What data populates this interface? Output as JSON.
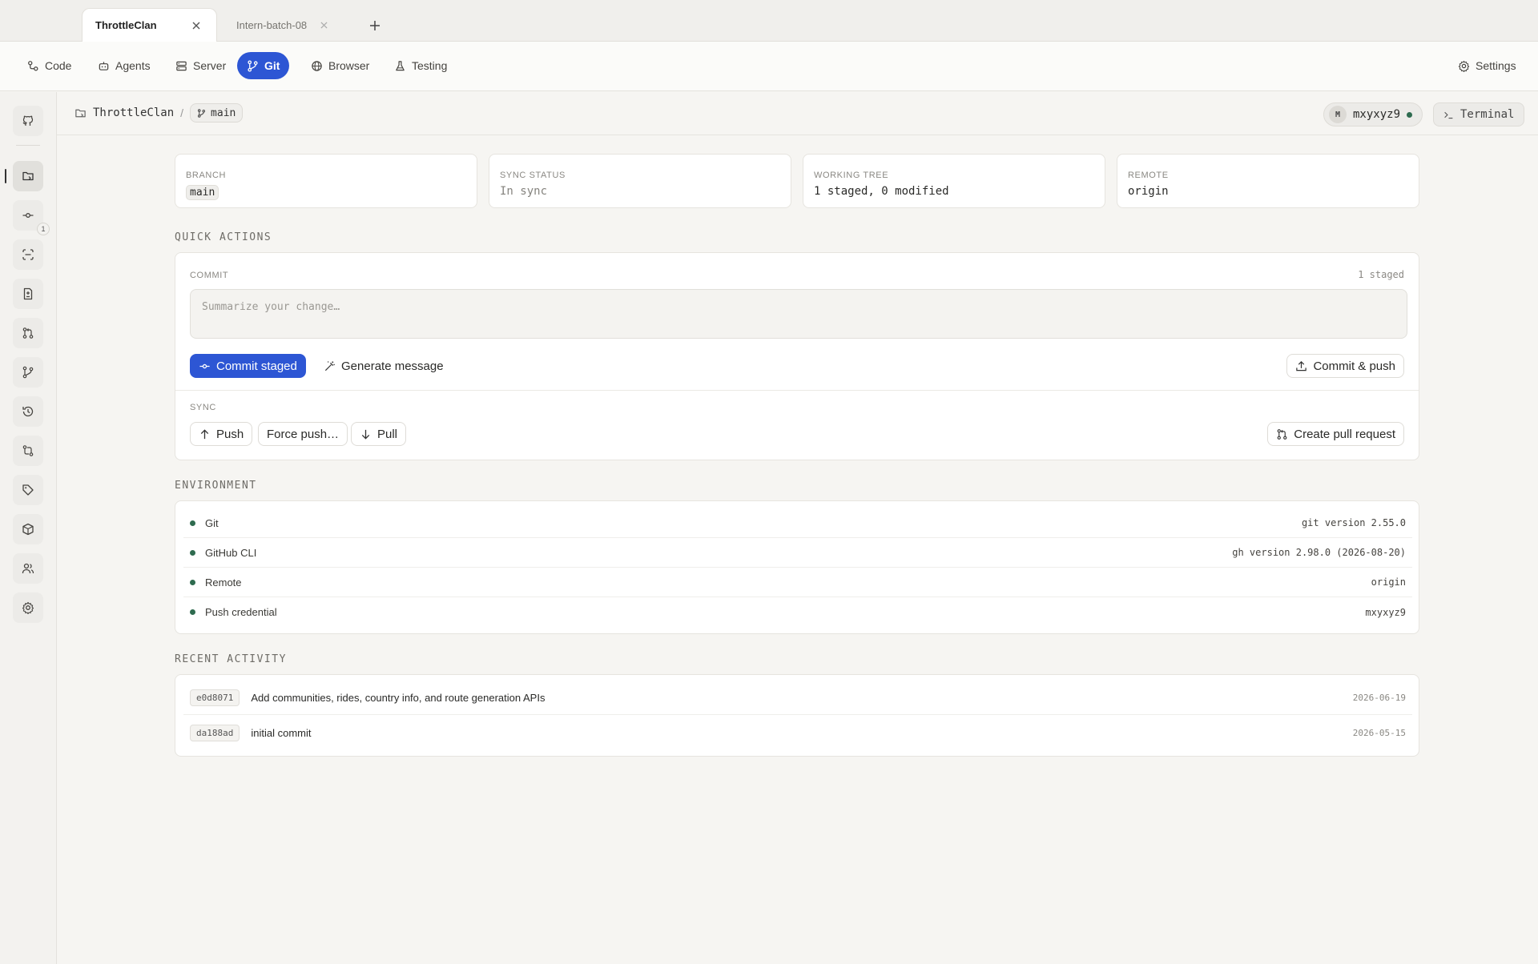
{
  "tabs": [
    {
      "label": "ThrottleClan",
      "active": true
    },
    {
      "label": "Intern-batch-08",
      "active": false
    }
  ],
  "nav": {
    "items": [
      {
        "label": "Code",
        "icon": "code-icon"
      },
      {
        "label": "Agents",
        "icon": "robot-icon"
      },
      {
        "label": "Server",
        "icon": "server-icon"
      },
      {
        "label": "Git",
        "icon": "git-branch-icon",
        "active": true
      },
      {
        "label": "Browser",
        "icon": "globe-icon"
      },
      {
        "label": "Testing",
        "icon": "flask-icon"
      }
    ],
    "settings_label": "Settings"
  },
  "rail": {
    "items": [
      {
        "name": "github-icon"
      },
      {
        "name": "repository-icon",
        "active": true
      },
      {
        "name": "commit-icon",
        "badge": "1"
      },
      {
        "name": "scan-icon"
      },
      {
        "name": "file-diff-icon"
      },
      {
        "name": "pull-request-icon"
      },
      {
        "name": "branch-icon"
      },
      {
        "name": "history-icon"
      },
      {
        "name": "compare-icon"
      },
      {
        "name": "tag-icon"
      },
      {
        "name": "package-icon"
      },
      {
        "name": "users-icon"
      },
      {
        "name": "settings-icon"
      }
    ]
  },
  "breadcrumb": {
    "repo": "ThrottleClan",
    "separator": "/",
    "branch": "main"
  },
  "user": {
    "initial": "M",
    "name": "mxyxyz9",
    "status_color": "#2e6b4f"
  },
  "terminal_label": "Terminal",
  "stats": {
    "branch": {
      "label": "BRANCH",
      "value": "main"
    },
    "sync": {
      "label": "SYNC STATUS",
      "value": "In sync"
    },
    "tree": {
      "label": "WORKING TREE",
      "value": "1 staged, 0 modified"
    },
    "remote": {
      "label": "REMOTE",
      "value": "origin"
    }
  },
  "quick_actions": {
    "title": "QUICK ACTIONS",
    "commit": {
      "label": "COMMIT",
      "staged": "1 staged",
      "placeholder": "Summarize your change…",
      "commit_staged": "Commit staged",
      "generate": "Generate message",
      "commit_push": "Commit & push"
    },
    "sync": {
      "label": "SYNC",
      "push": "Push",
      "force_push": "Force push…",
      "pull": "Pull",
      "create_pr": "Create pull request"
    }
  },
  "environment": {
    "title": "ENVIRONMENT",
    "rows": [
      {
        "name": "Git",
        "value": "git version 2.55.0"
      },
      {
        "name": "GitHub CLI",
        "value": "gh version 2.98.0 (2026-08-20)"
      },
      {
        "name": "Remote",
        "value": "origin"
      },
      {
        "name": "Push credential",
        "value": "mxyxyz9"
      }
    ]
  },
  "activity": {
    "title": "RECENT ACTIVITY",
    "rows": [
      {
        "hash": "e0d8071",
        "message": "Add communities, rides, country info, and route generation APIs",
        "date": "2026-06-19"
      },
      {
        "hash": "da188ad",
        "message": "initial commit",
        "date": "2026-05-15"
      }
    ]
  },
  "colors": {
    "accent": "#2d56d4",
    "status_ok": "#2e6b4f",
    "background": "#f6f5f2"
  }
}
